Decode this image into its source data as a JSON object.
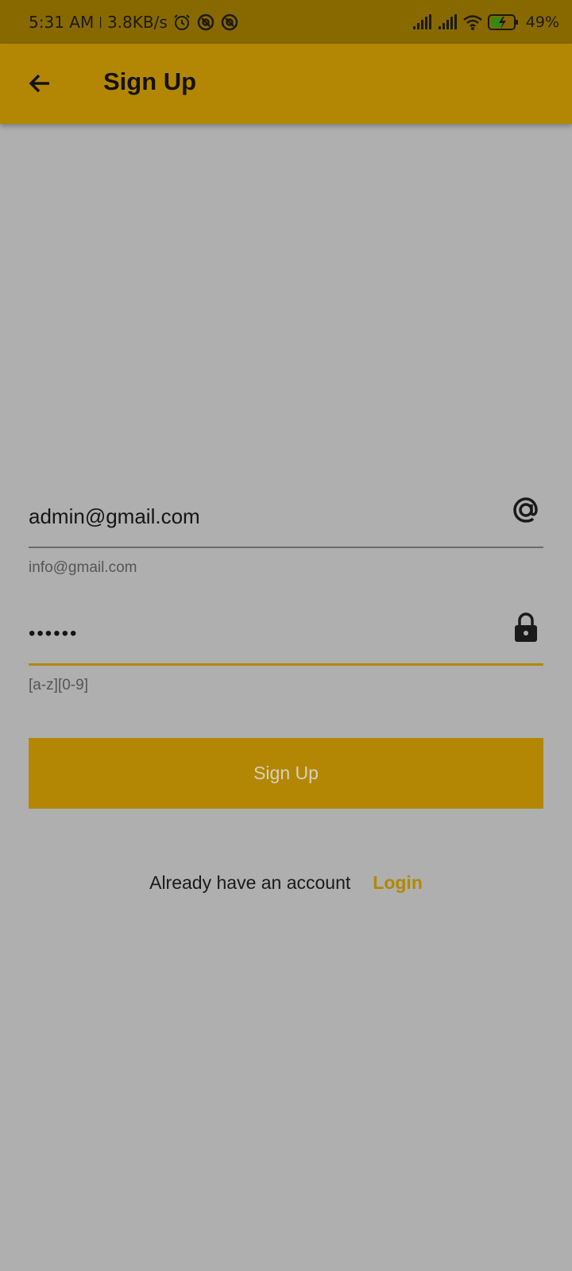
{
  "status_bar": {
    "time": "5:31 AM",
    "speed": "3.8KB/s",
    "battery": "49%"
  },
  "app_bar": {
    "title": "Sign Up"
  },
  "email": {
    "value": "admin@gmail.com",
    "hint": "info@gmail.com"
  },
  "password": {
    "value": "••••••",
    "hint": "[a-z][0-9]"
  },
  "signup_button": {
    "label": "Sign Up"
  },
  "footer": {
    "text": "Already have an account",
    "login_label": "Login"
  },
  "colors": {
    "primary": "#b38703",
    "status_bar": "#876900",
    "background": "#afafaf"
  },
  "icons": {
    "back": "arrow-back-icon",
    "email": "at-sign-icon",
    "password": "lock-icon"
  }
}
